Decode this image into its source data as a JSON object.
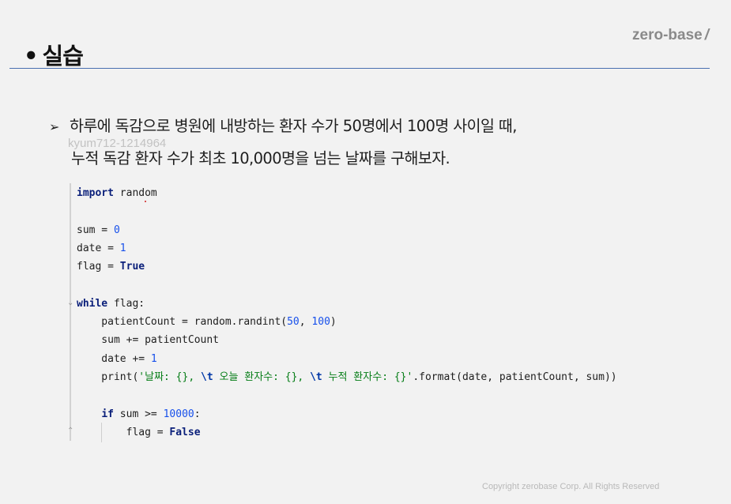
{
  "slide": {
    "bullet": "•",
    "title": "실습",
    "brand": "zero-base",
    "brand_slash": "/"
  },
  "question": {
    "arrow": "➢",
    "line1": "하루에 독감으로 병원에 내방하는 환자 수가 50명에서 100명 사이일 때,",
    "line2": "누적 독감 환자 수가 최초 10,000명을 넘는 날짜를 구해보자."
  },
  "watermark": "kyum712-1214964",
  "code": {
    "l1_kw": "import",
    "l1_rest": " random",
    "l3_a": "sum = ",
    "l3_num": "0",
    "l4_a": "date = ",
    "l4_num": "1",
    "l5_a": "flag = ",
    "l5_kw": "True",
    "l7_kw": "while",
    "l7_rest": " flag:",
    "l8_a": "    patientCount = random.randint(",
    "l8_n1": "50",
    "l8_b": ", ",
    "l8_n2": "100",
    "l8_c": ")",
    "l9": "    sum += patientCount",
    "l10_a": "    date += ",
    "l10_num": "1",
    "l11_a": "    print(",
    "l11_s1": "'날짜: {}, ",
    "l11_e1": "\\t",
    "l11_s2": " 오늘 환자수: {}, ",
    "l11_e2": "\\t",
    "l11_s3": " 누적 환자수: {}'",
    "l11_b": ".format(date, patientCount, sum))",
    "l13_ind": "    ",
    "l13_kw": "if",
    "l13_a": " sum >= ",
    "l13_num": "10000",
    "l13_b": ":",
    "l14_a": "        flag = ",
    "l14_kw": "False"
  },
  "footer": {
    "copyright": "Copyright zerobase Corp. All Rights Reserved"
  },
  "colors": {
    "background": "#f2f2f2",
    "rule": "#4a70b0",
    "keyword": "#0a1f7a",
    "number": "#1750eb",
    "string": "#067d17"
  }
}
